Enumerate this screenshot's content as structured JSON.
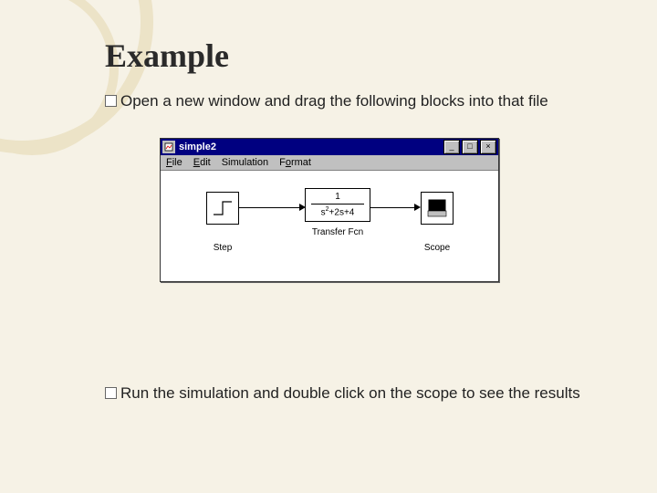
{
  "slide": {
    "title": "Example",
    "bullet1_lead": "Open",
    "bullet1_rest": " a new window and drag the following blocks into that file",
    "bullet2_lead": "Run",
    "bullet2_rest": " the simulation and double click on the scope to see the results"
  },
  "sim_window": {
    "title": "simple2",
    "menus": {
      "file": "File",
      "edit": "Edit",
      "simulation": "Simulation",
      "format": "Format"
    },
    "win_controls": {
      "minimize": "_",
      "maximize": "□",
      "close": "×"
    },
    "blocks": {
      "step": {
        "label": "Step"
      },
      "transfer_fcn": {
        "label": "Transfer Fcn",
        "numerator": "1",
        "denominator_html": "s²+2s+4"
      },
      "scope": {
        "label": "Scope"
      }
    }
  }
}
